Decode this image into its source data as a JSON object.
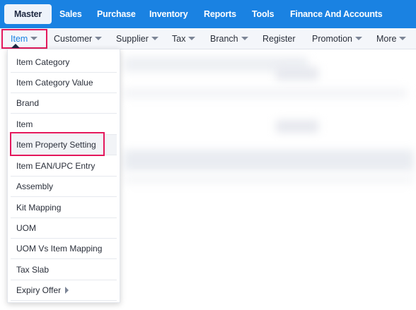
{
  "top_nav": {
    "tabs": [
      {
        "label": "Master",
        "active": true
      },
      {
        "label": "Sales"
      },
      {
        "label": "Purchase"
      },
      {
        "label": "Inventory"
      },
      {
        "label": "Reports"
      },
      {
        "label": "Tools"
      },
      {
        "label": "Finance And Accounts"
      }
    ]
  },
  "sub_nav": {
    "items": [
      {
        "label": "Item",
        "has_dropdown": true,
        "active": true
      },
      {
        "label": "Customer",
        "has_dropdown": true
      },
      {
        "label": "Supplier",
        "has_dropdown": true
      },
      {
        "label": "Tax",
        "has_dropdown": true
      },
      {
        "label": "Branch",
        "has_dropdown": true
      },
      {
        "label": "Register",
        "has_dropdown": false
      },
      {
        "label": "Promotion",
        "has_dropdown": true
      },
      {
        "label": "More",
        "has_dropdown": true
      }
    ]
  },
  "item_menu": {
    "items": [
      {
        "label": "Item Category"
      },
      {
        "label": "Item Category Value"
      },
      {
        "label": "Brand"
      },
      {
        "label": "Item"
      },
      {
        "label": "Item Property Setting",
        "highlighted": true
      },
      {
        "label": "Item EAN/UPC Entry"
      },
      {
        "label": "Assembly"
      },
      {
        "label": "Kit Mapping"
      },
      {
        "label": "UOM"
      },
      {
        "label": "UOM Vs Item Mapping"
      },
      {
        "label": "Tax Slab"
      },
      {
        "label": "Expiry Offer",
        "has_submenu": true
      }
    ]
  },
  "colors": {
    "topbar": "#1a82e2",
    "highlight": "#e4185c",
    "active_text": "#1a82e2"
  }
}
